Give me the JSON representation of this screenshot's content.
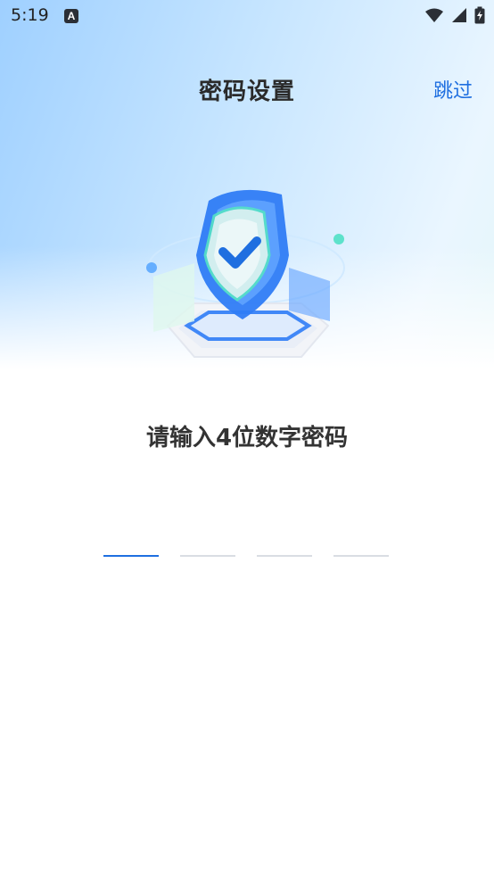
{
  "status_bar": {
    "time": "5:19",
    "left_icon": "A",
    "icons": [
      "wifi-icon",
      "signal-icon",
      "battery-charging-icon"
    ]
  },
  "header": {
    "title": "密码设置",
    "skip_label": "跳过"
  },
  "illustration": {
    "semantic": "security-shield-illustration"
  },
  "prompt": {
    "text": "请输入4位数字密码"
  },
  "pin": {
    "length": 4,
    "entered_digits": 0,
    "active_index": 0
  },
  "colors": {
    "accent": "#1f6fe0",
    "title": "#2a2a2a",
    "prompt": "#333333",
    "inactive_slot": "#d9dde3"
  }
}
